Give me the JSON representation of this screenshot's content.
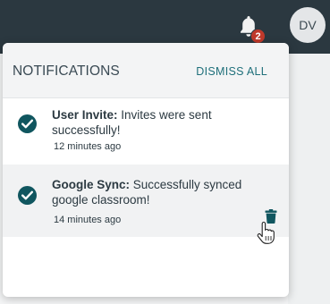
{
  "topbar": {
    "notifications_count": "2",
    "avatar_initials": "DV"
  },
  "notifications_panel": {
    "title": "NOTIFICATIONS",
    "dismiss_all_label": "DISMISS ALL",
    "items": [
      {
        "source": "User Invite:",
        "message": " Invites were sent successfully!",
        "time": "12 minutes ago",
        "status_icon": "check-circle-icon"
      },
      {
        "source": "Google Sync:",
        "message": " Successfully synced google classroom!",
        "time": "14 minutes ago",
        "status_icon": "check-circle-icon",
        "action_icon": "trash-icon"
      }
    ]
  },
  "colors": {
    "topbar": "#2b3840",
    "accent": "#1e6f7a",
    "check": "#10565f",
    "badge": "#c0392b"
  }
}
